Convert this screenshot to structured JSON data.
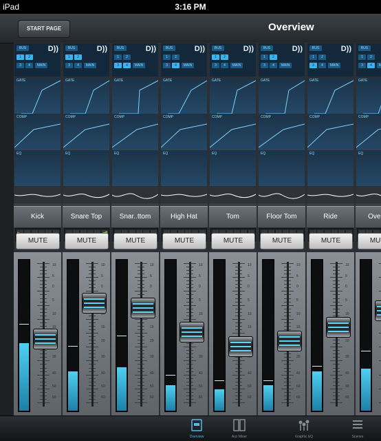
{
  "status": {
    "carrier": "iPad",
    "time": "3:16 PM"
  },
  "nav": {
    "start_page": "START PAGE",
    "title": "Overview"
  },
  "routing": {
    "bus_label": "BUS",
    "main_label": "MAIN",
    "dante": "D))",
    "gate_label": "GATE",
    "comp_label": "COMP",
    "eq_label": "EQ"
  },
  "mute_label": "MUTE",
  "channels": [
    {
      "name": "Kick",
      "fader_level": 0.48,
      "meter_level": 0.45,
      "meter_peak": 0.58,
      "active": [
        "1",
        "2"
      ]
    },
    {
      "name": "Snare Top",
      "fader_level": 0.76,
      "meter_level": 0.26,
      "meter_peak": 0.43,
      "active": [
        "1",
        "2"
      ]
    },
    {
      "name": "Snar..ttom",
      "fader_level": 0.72,
      "meter_level": 0.29,
      "meter_peak": 0.5,
      "active": [
        "3",
        "4"
      ]
    },
    {
      "name": "High Hat",
      "fader_level": 0.53,
      "meter_level": 0.17,
      "meter_peak": 0.24,
      "active": [
        "4"
      ]
    },
    {
      "name": "Tom",
      "fader_level": 0.42,
      "meter_level": 0.14,
      "meter_peak": 0.2,
      "active": [
        "1",
        "2"
      ]
    },
    {
      "name": "Floor Tom",
      "fader_level": 0.46,
      "meter_level": 0.17,
      "meter_peak": 0.2,
      "active": [
        "2"
      ]
    },
    {
      "name": "Ride",
      "fader_level": 0.57,
      "meter_level": 0.26,
      "meter_peak": 0.3,
      "active": [
        "3"
      ]
    },
    {
      "name": "Overh..",
      "fader_level": 0.7,
      "meter_level": 0.28,
      "meter_peak": 0.4,
      "active": [
        "4"
      ]
    }
  ],
  "scale_labels": [
    "10",
    "5",
    "0",
    "5",
    "10",
    "15",
    "20",
    "30",
    "40",
    "50",
    "60"
  ],
  "tabs": [
    {
      "label": "Overview",
      "icon": "overview-icon",
      "active": true
    },
    {
      "label": "Aux Mixer",
      "icon": "aux-mixer-icon",
      "active": false
    },
    {
      "label": "Graphic EQ",
      "icon": "graphic-eq-icon",
      "active": false
    },
    {
      "label": "Scenes",
      "icon": "scenes-icon",
      "active": false
    }
  ],
  "colors": {
    "accent": "#3ab4ee",
    "meter": "#4fd0f0",
    "routing_bg": "#13283a"
  }
}
